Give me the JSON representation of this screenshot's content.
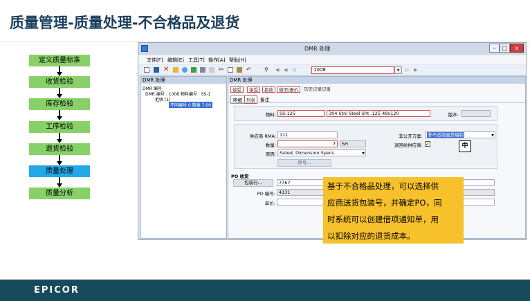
{
  "slide": {
    "title": "质量管理-质量处理-不合格品及退货",
    "logo": "EPICOR"
  },
  "flow": {
    "steps": [
      "定义质量标准",
      "收货检验",
      "库存检验",
      "工序检验",
      "退货检验",
      "质量处理",
      "质量分析"
    ],
    "active_step": "质量处理",
    "colors": {
      "step": "#88d168",
      "active": "#22a8e6"
    }
  },
  "window": {
    "title": "DMR 处理",
    "controls": [
      "–",
      "□",
      "x"
    ],
    "menu": [
      "文件[F]",
      "编辑[E]",
      "工具[T]",
      "操作[A]",
      "帮助[H]"
    ],
    "toolbar_search_value": "1008",
    "left_panel": {
      "header": "DMR 处理",
      "tree": {
        "root": "DMR 编号",
        "node": "DMR 编号 : 1008 物料编号 : SS-1",
        "child": "拒收 (1)",
        "leaf": "不同编号 0 数量 7.00"
      }
    },
    "right_panel": {
      "header": "DMR 处理",
      "action_buttons": [
        "接受",
        "接受",
        "拒收",
        "借项/报价",
        "历史记录记录"
      ],
      "tabs": [
        "明细",
        "列表",
        "备注"
      ],
      "part": {
        "label": "物料:",
        "value": "SS-125",
        "description": "304 Stnl Steel Sht .125 48x120",
        "rev_label": "版本:",
        "rev_value": ""
      },
      "vendor": {
        "rma_label": "供应商 RMA:",
        "rma_value": "111",
        "qty_label": "数量:",
        "qty_value": "7",
        "uom": "SH",
        "reason_label": "原因:",
        "reason_value": "Failed, Dimension Specs",
        "serial_button": "序号...",
        "nc_label": "非公开方案:",
        "nc_value": "非不适用退货编制",
        "return_label": "退回给供应商:",
        "return_checked": "✓"
      },
      "po": {
        "section_title": "PO 收货",
        "packslip_button": "包装行...",
        "packslip_value": "7767",
        "po_label": "PO 编号:",
        "po_value": "4131",
        "price_label": "单价:",
        "price_value": ""
      }
    }
  },
  "ime_indicator": "中",
  "callout": {
    "lines": [
      "基于不合格品处理，可以选择供",
      "应商送货包装号，并确定PO，同",
      "时系统可以创建借项通知单，用",
      "以扣除对应的退货成本。"
    ]
  }
}
